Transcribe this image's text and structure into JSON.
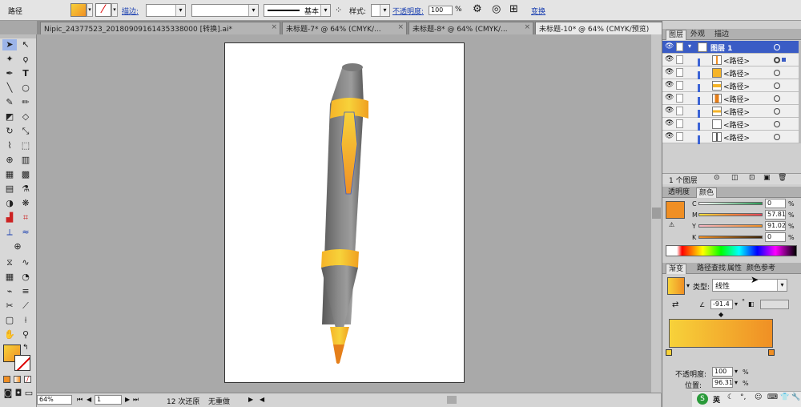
{
  "control_bar": {
    "object_type": "路径",
    "stroke_label": "描边:",
    "stroke_profile": "基本",
    "style_label": "样式:",
    "opacity_label": "不透明度:",
    "opacity_value": "100",
    "opacity_unit": "%",
    "transform_label": "变换"
  },
  "doc_tabs": [
    {
      "label": "Nipic_24377523_20180909161435338000 [转换].ai*"
    },
    {
      "label": "未标题-7* @ 64% (CMYK/..."
    },
    {
      "label": "未标题-8* @ 64% (CMYK/..."
    },
    {
      "label": "未标题-10* @ 64% (CMYK/预览)"
    }
  ],
  "status": {
    "zoom": "64%",
    "page": "1",
    "undo_text": "12 次还原",
    "redo_text": "无重做"
  },
  "layers_panel": {
    "tabs": [
      "图层",
      "外观",
      "描边"
    ],
    "layer_name": "图层 1",
    "paths": [
      "<路径>",
      "<路径>",
      "<路径>",
      "<路径>",
      "<路径>",
      "<路径>",
      "<路径>"
    ],
    "count_text": "1 个图层"
  },
  "color_panel": {
    "tabs": [
      "透明度",
      "颜色"
    ],
    "channels": [
      {
        "name": "C",
        "value": "0",
        "unit": "%"
      },
      {
        "name": "M",
        "value": "57.81",
        "unit": "%"
      },
      {
        "name": "Y",
        "value": "91.02",
        "unit": "%"
      },
      {
        "name": "K",
        "value": "0",
        "unit": "%"
      }
    ]
  },
  "gradient_panel": {
    "tabs": [
      "渐变",
      "路径查找",
      "属性",
      "颜色参考"
    ],
    "type_label": "类型:",
    "type_value": "线性",
    "angle_value": "-91.4",
    "angle_unit": "°",
    "opacity_label": "不透明度:",
    "opacity_value": "100",
    "opacity_unit": "%",
    "location_label": "位置:",
    "location_value": "96.31",
    "location_unit": "%"
  },
  "taskbar": {
    "ime": "英"
  },
  "colors": {
    "pencil_gray": "#6e6e6e",
    "band_yellow": "#f5c132",
    "band_orange": "#f09a1e",
    "tip_orange": "#e57f1a",
    "layer_select": "#3a5cc5",
    "current_fill": "#f08f24"
  },
  "icons": [
    "selection-tool",
    "direct-selection-tool",
    "magic-wand-tool",
    "lasso-tool",
    "pen-tool",
    "type-tool",
    "line-tool",
    "ellipse-tool",
    "paintbrush-tool",
    "pencil-tool",
    "eraser-tool",
    "rotate-tool",
    "scale-tool",
    "zoom-tool",
    "hand-tool",
    "eye-icon",
    "trash-icon",
    "new-layer-icon"
  ]
}
